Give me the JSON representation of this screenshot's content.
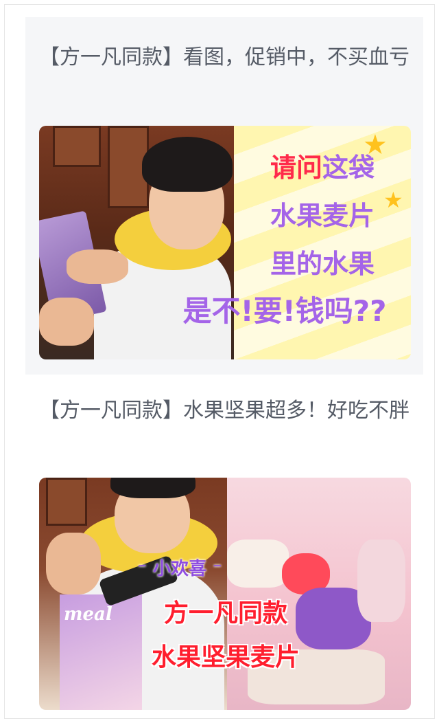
{
  "feed": {
    "items": [
      {
        "title": "【方一凡同款】看图，促销中，不买血亏",
        "thumbnail": {
          "lines": [
            {
              "red": "请问",
              "rest": "这袋"
            },
            {
              "red": "",
              "rest": "水果麦片"
            },
            {
              "red": "",
              "rest": "里的水果"
            },
            {
              "red": "",
              "rest": "是不!要!钱吗??"
            }
          ]
        }
      },
      {
        "title": "【方一凡同款】水果坚果超多！好吃不胖",
        "thumbnail": {
          "tag": "⁻ 小欢喜 ⁻",
          "line1": "方一凡同款",
          "line2": "水果坚果麦片",
          "bag_label": "meal"
        }
      }
    ]
  },
  "colors": {
    "title_text": "#555b66",
    "card1_bg": "#f5f6f8",
    "promo_purple": "#a464e8",
    "promo_red": "#ff2a4a",
    "overlay_red": "#ff1e2e"
  }
}
